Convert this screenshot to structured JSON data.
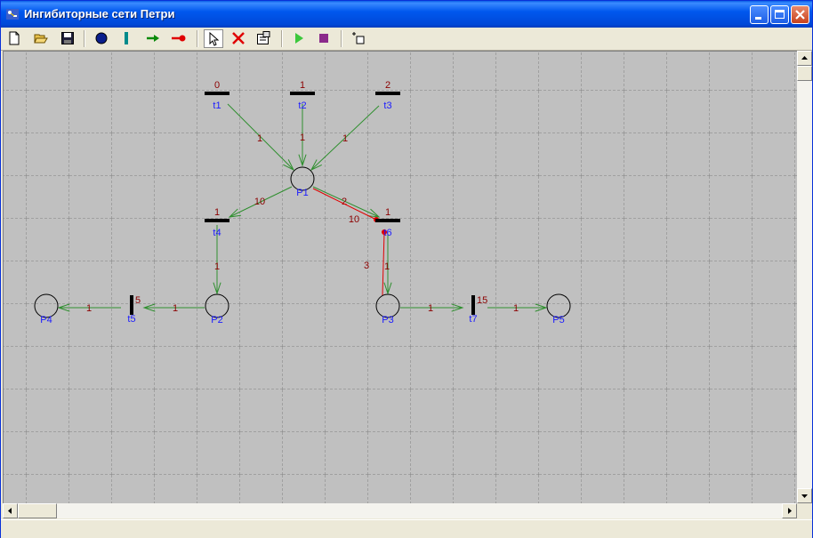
{
  "window": {
    "title": "Ингибиторные сети Петри"
  },
  "colors": {
    "grid_bg": "#c0c0c0",
    "arc": "#2f8f2f",
    "inhibitor": "#e00000",
    "label": "#1a1aff",
    "weight": "#8b0000"
  },
  "toolbar": {
    "items": [
      {
        "name": "new-file-icon"
      },
      {
        "name": "open-folder-icon"
      },
      {
        "name": "save-disk-icon"
      },
      {
        "name": "place-tool-icon"
      },
      {
        "name": "transition-tool-icon"
      },
      {
        "name": "arc-tool-icon"
      },
      {
        "name": "inhibitor-arc-tool-icon"
      },
      {
        "name": "select-pointer-icon"
      },
      {
        "name": "delete-x-icon"
      },
      {
        "name": "properties-icon"
      },
      {
        "name": "play-icon"
      },
      {
        "name": "stop-icon"
      },
      {
        "name": "step-icon"
      }
    ]
  },
  "net": {
    "transitions": [
      {
        "id": "t1",
        "label": "t1",
        "value": "0",
        "orient": "h"
      },
      {
        "id": "t2",
        "label": "t2",
        "value": "1",
        "orient": "h"
      },
      {
        "id": "t3",
        "label": "t3",
        "value": "2",
        "orient": "h"
      },
      {
        "id": "t4",
        "label": "t4",
        "value": "1",
        "orient": "h"
      },
      {
        "id": "t6",
        "label": "t6",
        "value": "1",
        "orient": "h"
      },
      {
        "id": "t5",
        "label": "t5",
        "value": "5",
        "orient": "v"
      },
      {
        "id": "t7",
        "label": "t7",
        "value": "15",
        "orient": "v"
      }
    ],
    "places": [
      {
        "id": "P1",
        "label": "P1"
      },
      {
        "id": "P2",
        "label": "P2"
      },
      {
        "id": "P3",
        "label": "P3"
      },
      {
        "id": "P4",
        "label": "P4"
      },
      {
        "id": "P5",
        "label": "P5"
      }
    ],
    "arcs": [
      {
        "from": "t1",
        "to": "P1",
        "weight": "1",
        "type": "normal"
      },
      {
        "from": "t2",
        "to": "P1",
        "weight": "1",
        "type": "normal"
      },
      {
        "from": "t3",
        "to": "P1",
        "weight": "1",
        "type": "normal"
      },
      {
        "from": "P1",
        "to": "t4",
        "weight": "10",
        "type": "normal"
      },
      {
        "from": "P1",
        "to": "t6",
        "weight": "2",
        "type": "normal"
      },
      {
        "from": "P1",
        "to": "t6",
        "weight": "10",
        "type": "inhibitor"
      },
      {
        "from": "t4",
        "to": "P2",
        "weight": "1",
        "type": "normal"
      },
      {
        "from": "t6",
        "to": "P3",
        "weight": "1",
        "type": "normal"
      },
      {
        "from": "P3",
        "to": "t6",
        "weight": "3",
        "type": "inhibitor"
      },
      {
        "from": "P2",
        "to": "t5",
        "weight": "1",
        "type": "normal"
      },
      {
        "from": "t5",
        "to": "P4",
        "weight": "1",
        "type": "normal"
      },
      {
        "from": "P3",
        "to": "t7",
        "weight": "1",
        "type": "normal"
      },
      {
        "from": "t7",
        "to": "P5",
        "weight": "1",
        "type": "normal"
      }
    ]
  }
}
